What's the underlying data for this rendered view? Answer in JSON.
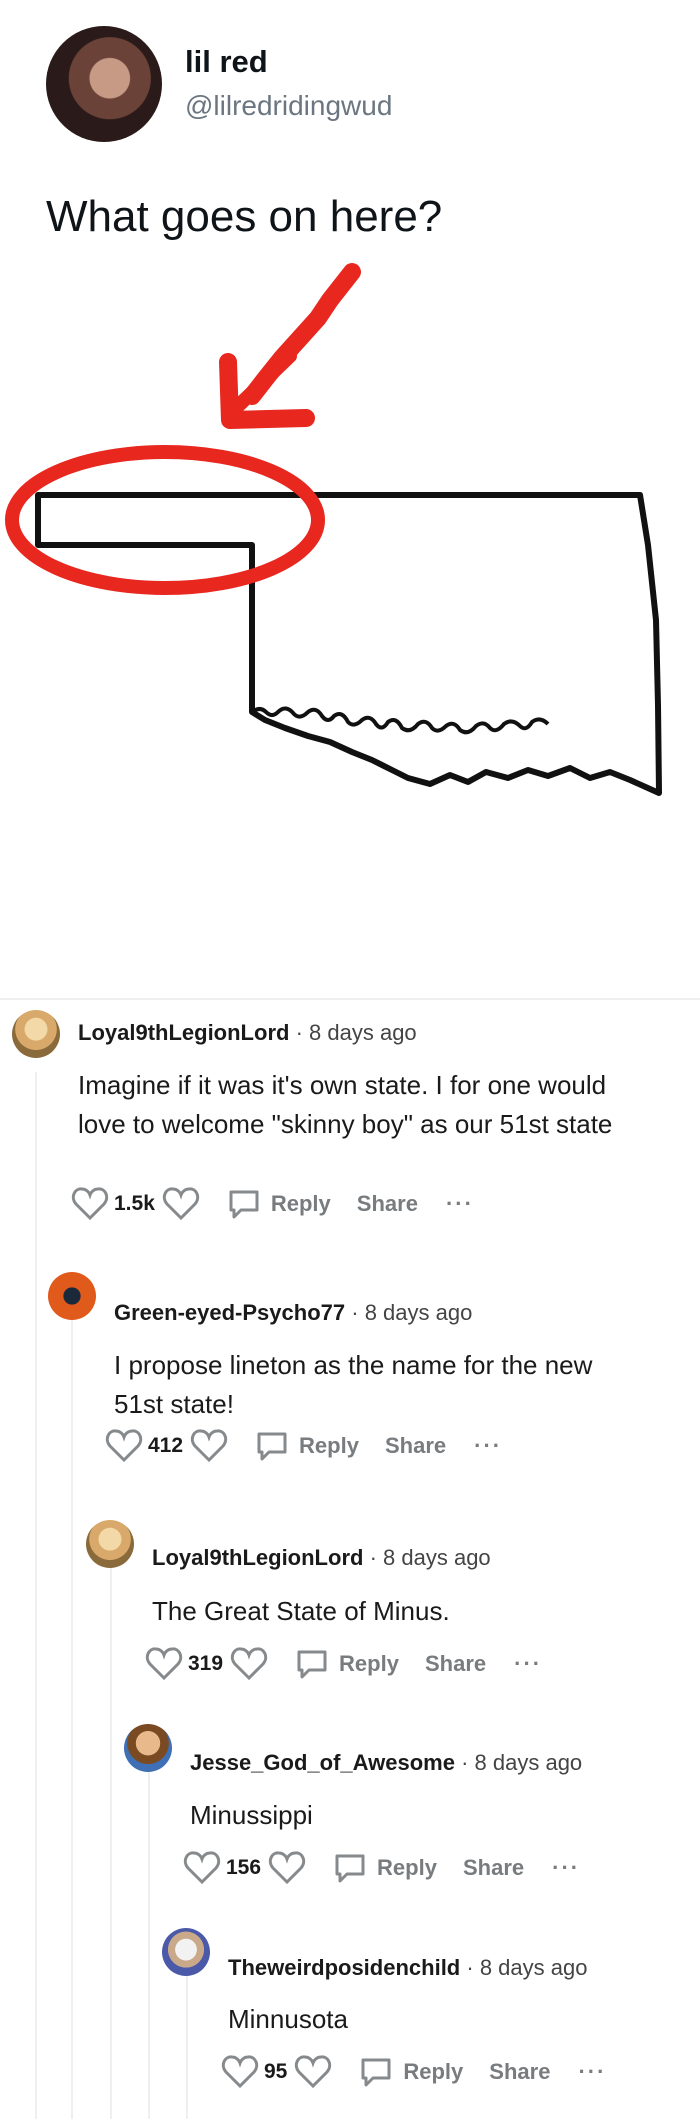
{
  "tweet": {
    "author_name": "lil red",
    "author_handle": "@lilredridingwud",
    "text": "What goes on here?"
  },
  "colors": {
    "annotation_red": "#e8271f",
    "map_outline": "#111111"
  },
  "comments": [
    {
      "username": "Loyal9thLegionLord",
      "age": "8 days ago",
      "body": "Imagine if it was it's own state. I for one would love to welcome \"skinny boy\" as our 51st state",
      "score": "1.5k",
      "reply_label": "Reply",
      "share_label": "Share",
      "more_label": "···"
    },
    {
      "username": "Green-eyed-Psycho77",
      "age": "8 days ago",
      "body": "I propose lineton as the name for the new 51st state!",
      "score": "412",
      "reply_label": "Reply",
      "share_label": "Share",
      "more_label": "···"
    },
    {
      "username": "Loyal9thLegionLord",
      "age": "8 days ago",
      "body": "The Great State of Minus.",
      "score": "319",
      "reply_label": "Reply",
      "share_label": "Share",
      "more_label": "···"
    },
    {
      "username": "Jesse_God_of_Awesome",
      "age": "8 days ago",
      "body": "Minussippi",
      "score": "156",
      "reply_label": "Reply",
      "share_label": "Share",
      "more_label": "···"
    },
    {
      "username": "Theweirdposidenchild",
      "age": "8 days ago",
      "body": "Minnusota",
      "score": "95",
      "reply_label": "Reply",
      "share_label": "Share",
      "more_label": "···"
    }
  ]
}
